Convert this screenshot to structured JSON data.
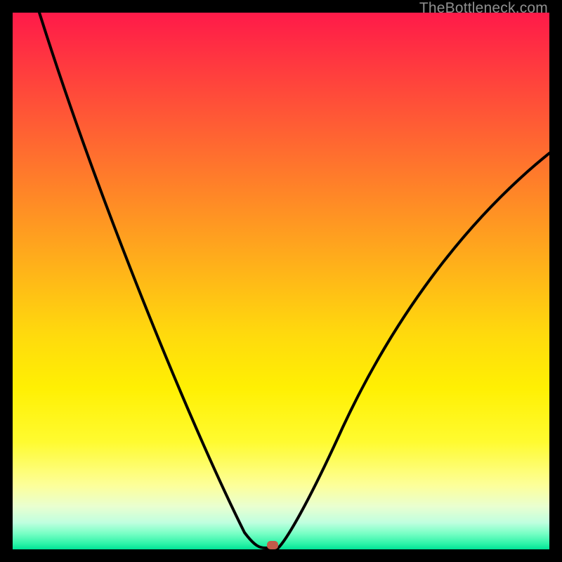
{
  "watermark": "TheBottleneck.com",
  "chart_data": {
    "type": "line",
    "title": "",
    "xlabel": "",
    "ylabel": "",
    "xlim": [
      0,
      100
    ],
    "ylim": [
      0,
      100
    ],
    "series": [
      {
        "name": "curve",
        "x": [
          5,
          10,
          15,
          20,
          25,
          30,
          35,
          40,
          44,
          46,
          48,
          50,
          55,
          60,
          65,
          70,
          75,
          80,
          85,
          90,
          95,
          100
        ],
        "values": [
          100,
          86,
          73,
          61,
          50,
          40,
          31,
          22,
          12,
          5,
          1,
          1,
          7,
          17,
          27,
          36,
          44,
          51,
          58,
          64,
          69,
          74
        ]
      }
    ],
    "marker": {
      "x": 49,
      "y": 0
    },
    "gradient_stops": [
      {
        "pos": 0.0,
        "color": "#ff1a49"
      },
      {
        "pos": 0.5,
        "color": "#ffba17"
      },
      {
        "pos": 0.8,
        "color": "#fffb30"
      },
      {
        "pos": 0.95,
        "color": "#c0ffdf"
      },
      {
        "pos": 1.0,
        "color": "#00e296"
      }
    ]
  }
}
